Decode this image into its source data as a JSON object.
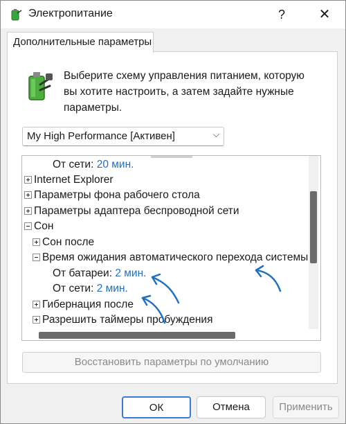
{
  "window": {
    "title": "Электропитание",
    "help_label": "?",
    "close_label": "✕"
  },
  "tab": {
    "label": "Дополнительные параметры"
  },
  "description": "Выберите схему управления питанием, которую вы хотите настроить, а затем задайте нужные параметры.",
  "scheme": {
    "selected": "My High Performance [Активен]",
    "chevron": "⌵"
  },
  "tree": {
    "rows": [
      {
        "label": "От сети:",
        "value": "20 мин."
      },
      {
        "label": "Internet Explorer"
      },
      {
        "label": "Параметры фона рабочего стола"
      },
      {
        "label": "Параметры адаптера беспроводной сети"
      },
      {
        "label": "Сон"
      },
      {
        "label": "Сон после"
      },
      {
        "label": "Время ожидания автоматического перехода системы"
      },
      {
        "label": "От батареи:",
        "value": "2 мин."
      },
      {
        "label": "От сети:",
        "value": "2 мин."
      },
      {
        "label": "Гибернация после"
      },
      {
        "label": "Разрешить таймеры пробуждения"
      }
    ]
  },
  "restore_label": "Восстановить параметры по умолчанию",
  "buttons": {
    "ok": "ОК",
    "cancel": "Отмена",
    "apply": "Применить"
  },
  "annotation_color": "#1f6fc4"
}
